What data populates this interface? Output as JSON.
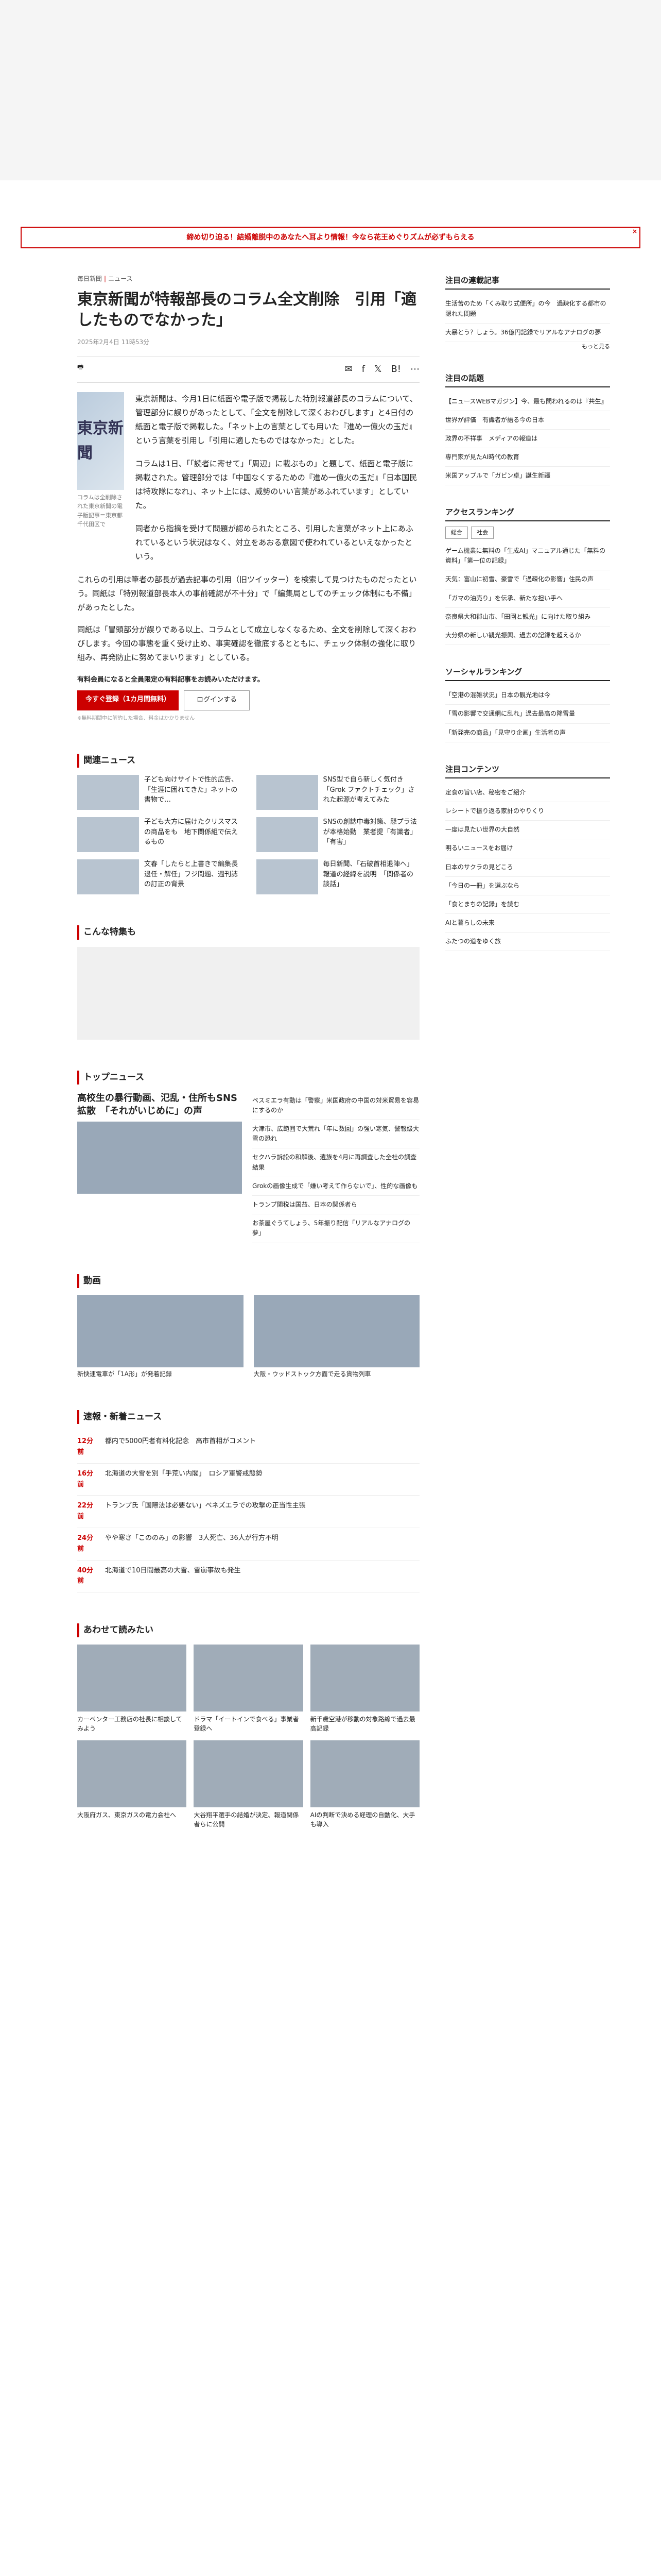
{
  "banner": {
    "text": "締め切り迫る！結婚離脱中のあなたへ耳より情報！今なら花王めぐりズムが必ずもらえる",
    "close": "×"
  },
  "crumbs": [
    "毎日新聞",
    "ニュース"
  ],
  "article": {
    "title": "東京新聞が特報部長のコラム全文削除　引用「適したものでなかった」",
    "date": "2025年2月4日 11時53分",
    "photo_text": "東京新聞",
    "caption": "コラムは全削除された東京新聞の電子版記事＝東京都千代田区で",
    "p1": "東京新聞は、今月1日に紙面や電子版で掲載した特別報道部長のコラムについて、管理部分に誤りがあったとして、「全文を削除して深くおわびします」と4日付の紙面と電子版で掲載した。「ネット上の言葉としても用いた『進め一億火の玉だ』という言葉を引用し「引用に適したものではなかった」とした。",
    "p2": "コラムは1日、「「読者に寄せて」「周辺」に載ぶもの」と題して、紙面と電子版に掲載された。管理部分では「中国なくするための『進め一億火の玉だ』「日本国民は特攻隊になれ」、ネット上には、威勢のいい言葉があふれています」としていた。",
    "p3": "同者から指摘を受けて問題が認められたところ、引用した言葉がネット上にあふれているという状況はなく、対立をあおる意図で使われているといえなかったという。",
    "body1": "これらの引用は筆者の部長が過去記事の引用（旧ツイッター）を検索して見つけたものだったという。同紙は「特別報道部長本人の事前確認が不十分」で「編集局としてのチェック体制にも不備」があったとした。",
    "body2": "同紙は「冒頭部分が誤りである以上、コラムとして成立しなくなるため、全文を削除して深くおわびします。今回の事態を重く受け止め、事実確認を徹底するとともに、チェック体制の強化に取り組み、再発防止に努めてまいります」としている。",
    "notice": "有料会員になると全員限定の有料記事をお読みいただけます。",
    "btn_join": "今すぐ登録（1カ月間無料）",
    "btn_login": "ログインする",
    "fine": "※無料期間中に解約した場合、料金はかかりません",
    "print": "印刷"
  },
  "related": {
    "heading": "関連ニュース",
    "items": [
      "子ども向けサイトで性的広告、「生涯に困れてきた」ネットの書物で…",
      "SNS型で自ら新しく気付き「Grok ファクトチェック」された起源が考えてみた",
      "子ども大方に届けたクリスマスの商品をも　地下関係組で伝えるもの",
      "SNSの創誌中毒対策、懸プラ法が本格始動　業者提「有識者」「有害」",
      "文春「したらと上書きで編集長退任・解任」フジ問題、週刊誌の訂正の背景",
      "毎日新聞、「石破首相退陣へ」報道の経緯を説明　「関係者の談話」"
    ]
  },
  "special": {
    "heading": "こんな特集も"
  },
  "top_news": {
    "heading": "トップニュース",
    "lead": "高校生の暴行動画、氾乱・住所もSNS拡散　「それがいじめに」の声",
    "items": [
      "ペスミエラ有動は「警察」米国政府の中国の対米貿易を容易にするのか",
      "大津市、広範囲で大荒れ「年に数回」の強い寒気、警報級大雪の恐れ",
      "セクハラ訴訟の和解後、遺族を4月に再調査した全社の調査結果",
      "Grokの画像生成で「嫌い考えて作らないで」、性的な画像も",
      "トランプ関税は国益、日本の関係者ら",
      "お茶屋ぐうてしょう、5年振り配信「リアルなアナログの夢」"
    ]
  },
  "ranking": {
    "heading": "速報・新着ニュース",
    "items": [
      {
        "time": "12分前",
        "text": "都内で5000円者有料化記念　高市首相がコメント"
      },
      {
        "time": "16分前",
        "text": "北海道の大雪を別「手荒い内閣」　ロシア軍警戒態勢"
      },
      {
        "time": "22分前",
        "text": "トランプ氏「国際法は必要ない」ベネズエラでの攻撃の正当性主張"
      },
      {
        "time": "24分前",
        "text": "やや寒さ「こののみ」の影響　3人死亡、36人が行方不明"
      },
      {
        "time": "40分前",
        "text": "北海道で10日間最高の大雪、雪崩事故も発生"
      }
    ]
  },
  "gallery": {
    "heading": "動画",
    "items": [
      "新快速電車が「1A形」が発着記録",
      "大阪・ウッドストック方面で走る貨物列車"
    ]
  },
  "pickup": {
    "heading": "あわせて読みたい",
    "items": [
      "カーペンター工務店の社長に相談してみよう",
      "ドラマ「イートインで食べる」事業者登録へ",
      "新千歳空港が移動の対象路線で過去最高記録",
      "大阪府ガス、東京ガスの電力会社へ",
      "大谷翔平選手の結婚が決定、報道関係者らに公開",
      "AIの判断で決める経理の自動化、大手も導入"
    ]
  },
  "side": {
    "editor": {
      "heading": "注目の連載記事",
      "more": "もっと見る",
      "items": [
        "生活苦のため「くみ取り式便所」の今　過疎化する都市の隠れた問題",
        "大暴とう？しょう。36億円記録でリアルなアナログの夢"
      ]
    },
    "tag": {
      "heading": "注目の話題",
      "items": [
        "【ニュースWEBマガジン】今、最も問われるのは『共生』",
        "世界が評価　有識者が語る今の日本",
        "政界の不祥事　メディアの報道は",
        "専門家が見たAI時代の教育",
        "米国アップルで「ガビン卓」誕生新疆"
      ]
    },
    "ranking": {
      "heading": "アクセスランキング",
      "tabs": [
        "総合",
        "社会"
      ],
      "items": [
        "ゲーム機業に無料の「生成AI」マニュアル通じた「無料の資料」「第一位の記録」",
        "天気：富山に初雪、豪雪で「過疎化の影響」住民の声",
        "「ガマの油売り」を伝承、新たな担い手へ",
        "奈良県大和郡山市、「田園と観光」に向けた取り組み",
        "大分県の新しい観光振興、過去の記録を超えるか"
      ]
    },
    "social": {
      "heading": "ソーシャルランキング",
      "items": [
        "「空港の混雑状況」日本の観光地は今",
        "「雪の影響で交通網に乱れ」過去最高の降雪量",
        "「新発売の商品」「見守り企画」生活者の声"
      ]
    },
    "contents": {
      "heading": "注目コンテンツ",
      "items": [
        "定食の旨い店、秘密をご紹介",
        "レシートで振り返る家計のやりくり",
        "一度は見たい世界の大自然",
        "明るいニュースをお届け",
        "日本のサクラの見どころ",
        "「今日の一冊」を選ぶなら",
        "「食とまちの記録」を読む",
        "AIと暮らしの未来",
        "ふたつの道をゆく旅"
      ]
    }
  }
}
